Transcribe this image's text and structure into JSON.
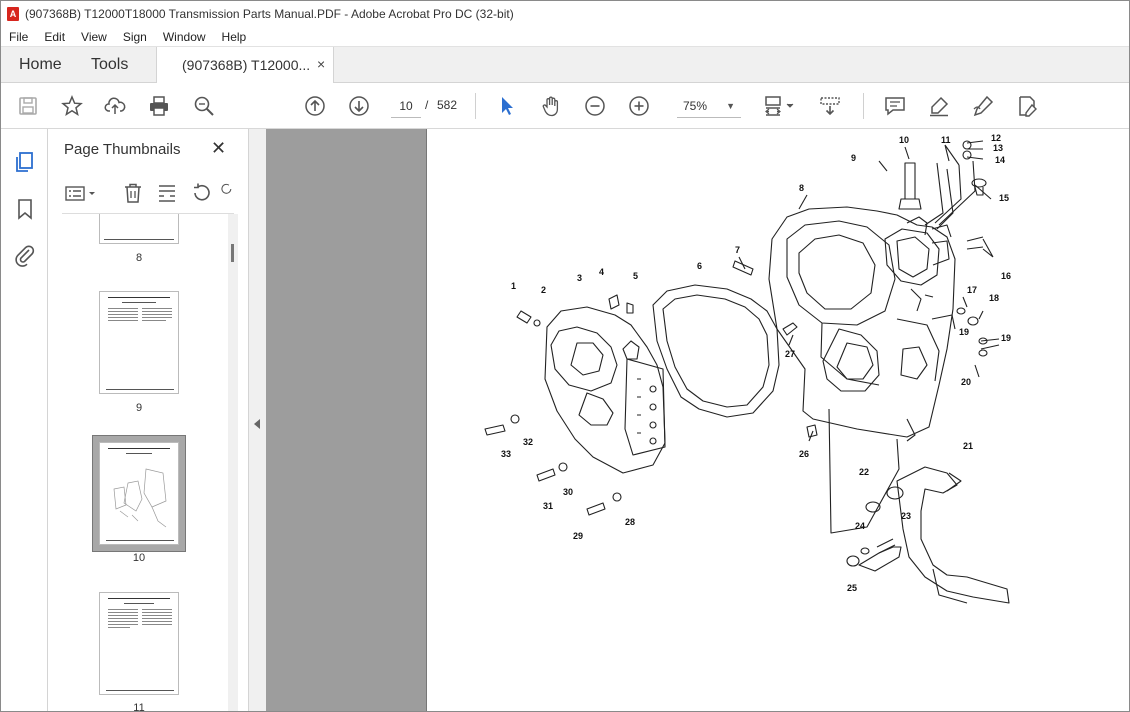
{
  "window": {
    "title": "(907368B) T12000T18000 Transmission Parts Manual.PDF - Adobe Acrobat Pro DC (32-bit)"
  },
  "menu": [
    "File",
    "Edit",
    "View",
    "Sign",
    "Window",
    "Help"
  ],
  "tabs": {
    "home": "Home",
    "tools": "Tools",
    "document": "(907368B) T12000...",
    "close": "×"
  },
  "toolbar": {
    "current_page": "10",
    "separator": "/",
    "total_pages": "582",
    "zoom": "75%",
    "icons": [
      "save-icon",
      "bookmark-star-icon",
      "upload-icon",
      "print-icon",
      "zoom-search-icon",
      "page-up-icon",
      "page-down-icon",
      "select-arrow-icon",
      "hand-icon",
      "zoom-out-icon",
      "zoom-in-icon",
      "page-view-icon",
      "scroll-mode-icon",
      "comment-icon",
      "highlight-icon",
      "draw-icon",
      "edit-pdf-icon"
    ]
  },
  "rail_icons": [
    "page-thumbnails-icon",
    "bookmarks-icon",
    "attachments-icon"
  ],
  "thumbnails": {
    "title": "Page Thumbnails",
    "close": "✕",
    "items": [
      {
        "label": "8"
      },
      {
        "label": "9"
      },
      {
        "label": "10"
      },
      {
        "label": "11"
      }
    ],
    "selected": "10"
  },
  "diagram": {
    "callouts": [
      "1",
      "2",
      "3",
      "4",
      "5",
      "6",
      "7",
      "8",
      "9",
      "10",
      "11",
      "12",
      "13",
      "14",
      "15",
      "16",
      "17",
      "18",
      "19",
      "19",
      "20",
      "21",
      "22",
      "23",
      "24",
      "25",
      "26",
      "27",
      "28",
      "29",
      "30",
      "31",
      "32",
      "33"
    ]
  }
}
